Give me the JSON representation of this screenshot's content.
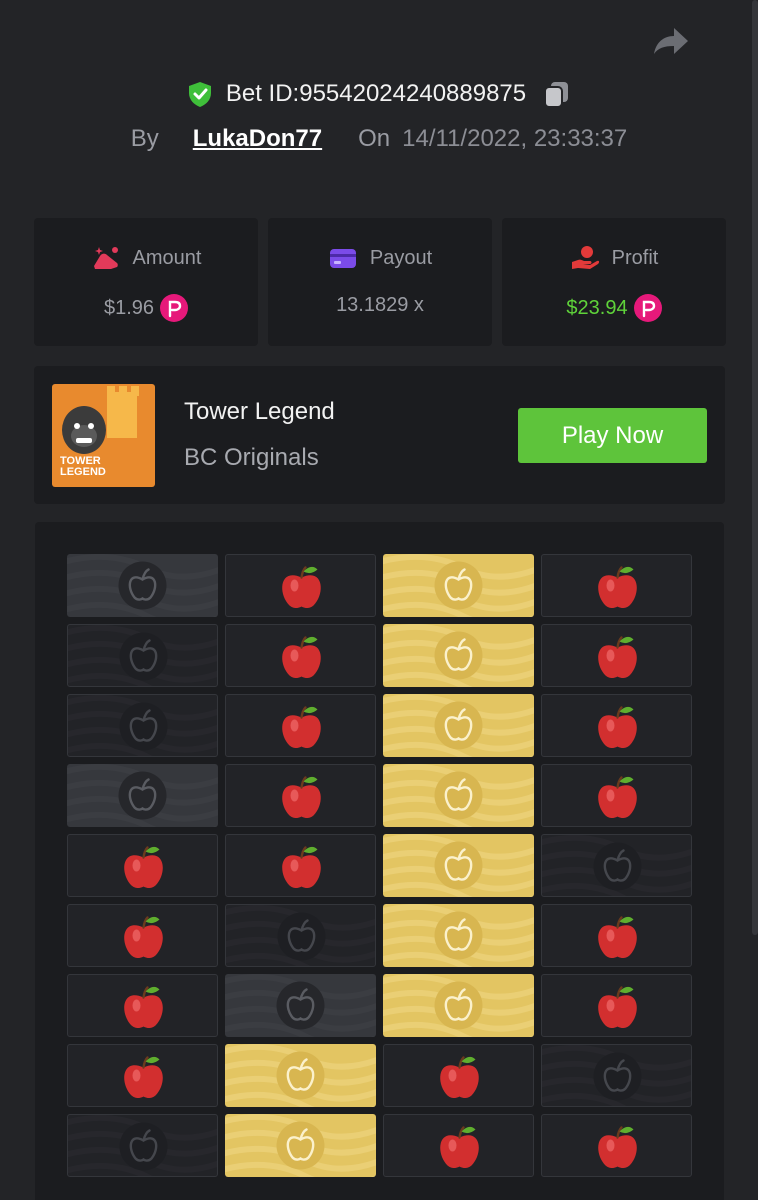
{
  "bet": {
    "label": "Bet ID: ",
    "id": "95542024240889875",
    "by_label": "By",
    "user": "LukaDon77",
    "on_label": "On",
    "datetime": "14/11/2022, 23:33:37"
  },
  "stats": {
    "amount": {
      "label": "Amount",
      "value": "$1.96"
    },
    "payout": {
      "label": "Payout",
      "value": "13.1829 x"
    },
    "profit": {
      "label": "Profit",
      "value": "$23.94"
    }
  },
  "game": {
    "name": "Tower Legend",
    "provider": "BC Originals",
    "thumb_text": [
      "TOWER",
      "LEGEND"
    ],
    "play_label": "Play Now"
  },
  "board": {
    "cols": 4,
    "legend": {
      "apple": "red apple",
      "dark": "unpicked empty",
      "gray": "revealed empty",
      "gold": "picked"
    },
    "rows": [
      [
        "gray",
        "apple",
        "gold",
        "apple"
      ],
      [
        "dark",
        "apple",
        "gold",
        "apple"
      ],
      [
        "dark",
        "apple",
        "gold",
        "apple"
      ],
      [
        "gray",
        "apple",
        "gold",
        "apple"
      ],
      [
        "apple",
        "apple",
        "gold",
        "dark"
      ],
      [
        "apple",
        "dark",
        "gold",
        "apple"
      ],
      [
        "apple",
        "gray",
        "gold",
        "apple"
      ],
      [
        "apple",
        "gold",
        "apple",
        "dark"
      ],
      [
        "dark",
        "gold",
        "apple",
        "apple"
      ]
    ]
  },
  "colors": {
    "background": "#232427",
    "panel": "#1b1c1f",
    "accent_green": "#5ec43b",
    "profit_green": "#5fd33a",
    "gold": "#e3c562",
    "apple_red": "#d22f2f",
    "coin_pink": "#e6197a"
  },
  "icons": [
    "share-icon",
    "verified-shield-icon",
    "copy-icon",
    "amount-icon",
    "payout-card-icon",
    "profit-hand-icon",
    "coin-icon",
    "apple-icon"
  ]
}
